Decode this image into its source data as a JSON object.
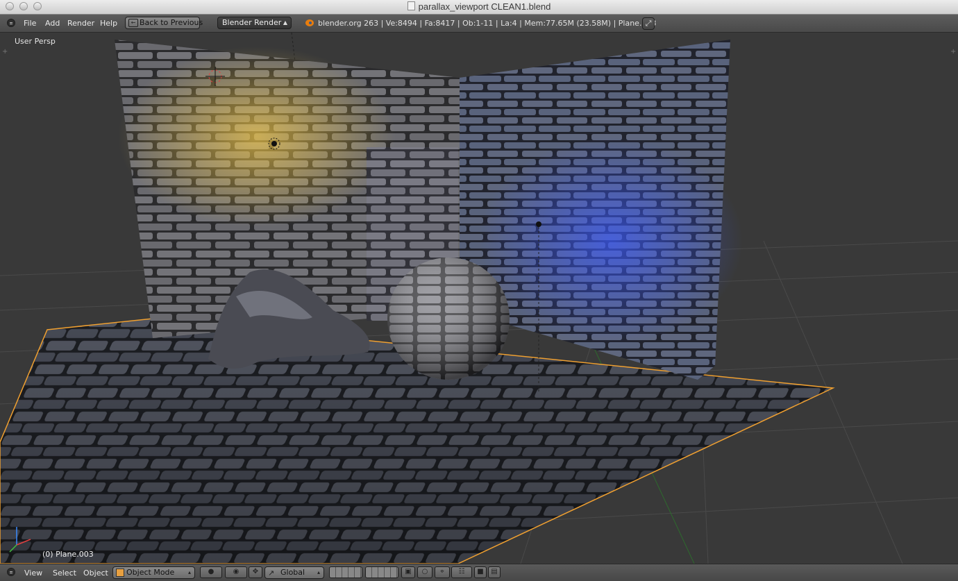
{
  "window": {
    "title": "parallax_viewport CLEAN1.blend"
  },
  "info_header": {
    "menus": [
      "File",
      "Add",
      "Render",
      "Help"
    ],
    "back_button": "Back to Previous",
    "render_engine": "Blender Render",
    "stats": "blender.org 263 | Ve:8494 | Fa:8417 | Ob:1-11 | La:4 | Mem:77.65M (23.58M) | Plane.003"
  },
  "viewport": {
    "view_label": "User Persp",
    "active_object": "(0) Plane.003"
  },
  "view_header": {
    "menus": [
      "View",
      "Select",
      "Object"
    ],
    "mode": "Object Mode",
    "orientation": "Global"
  },
  "colors": {
    "selection_outline": "#f0a030",
    "viewport_bg": "#393939",
    "header_bg": "#4f4f4f",
    "warm_light": "#e0b23a",
    "cool_light": "#3a50e0"
  },
  "icons": [
    "menu-toggle-icon",
    "blender-logo-icon",
    "fullscreen-icon",
    "cube-mode-icon",
    "shading-sphere-icon",
    "pivot-icon",
    "manipulator-icon",
    "layers-icon",
    "render-camera-icon"
  ]
}
